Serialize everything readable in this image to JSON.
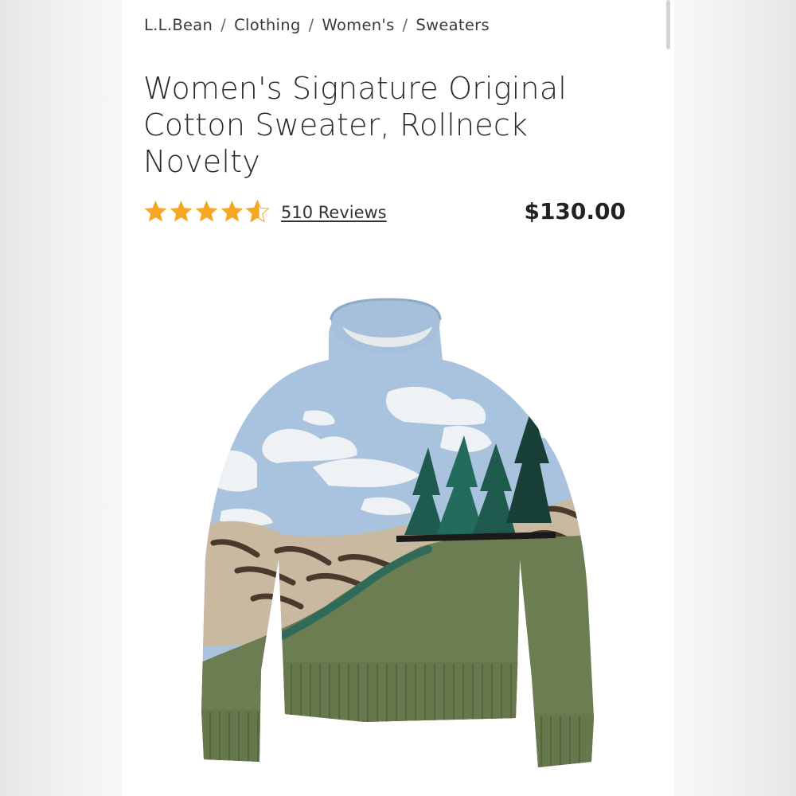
{
  "breadcrumb": {
    "items": [
      "L.L.Bean",
      "Clothing",
      "Women's",
      "Sweaters"
    ],
    "separator": "/"
  },
  "product": {
    "title": "Women's Signature Original Cotton Sweater, Rollneck Novelty",
    "rating": 4.6,
    "rating_max": 5,
    "reviews_label": "510 Reviews",
    "price": "$130.00",
    "image_icon": "sweater-product-image"
  },
  "colors": {
    "star": "#f5a623",
    "sky": "#a8c4e0",
    "cloud": "#eef2f4",
    "land": "#6e7f52",
    "rock": "#c8b8a0",
    "tree": "#1f5a4e"
  }
}
